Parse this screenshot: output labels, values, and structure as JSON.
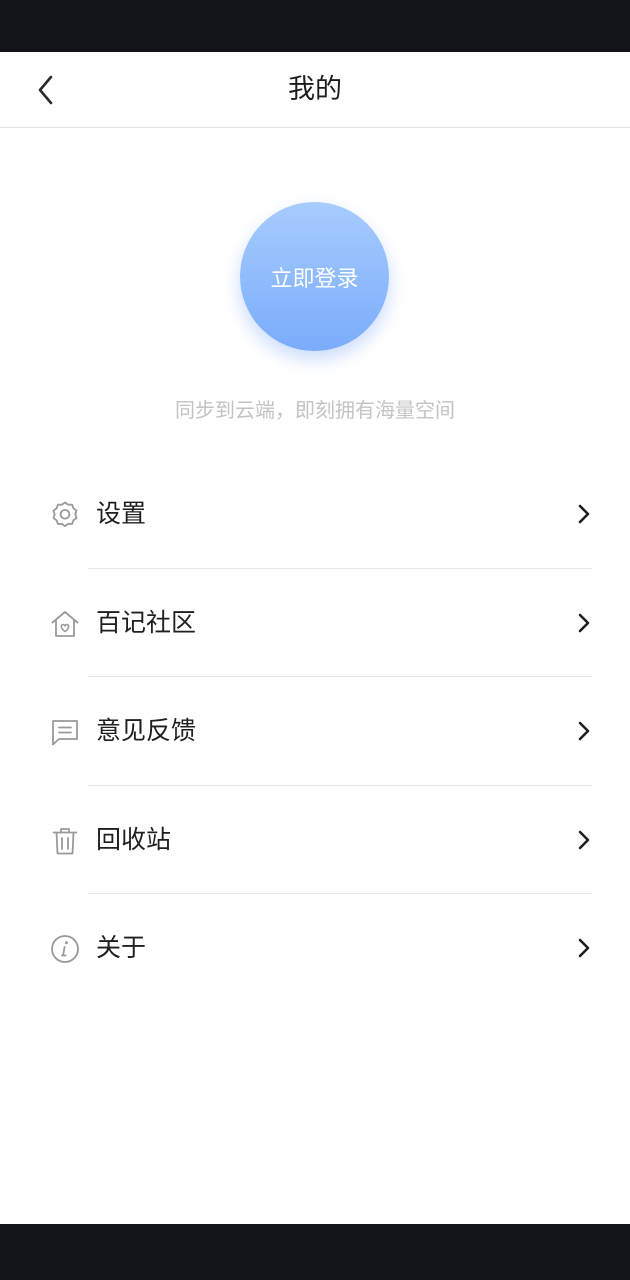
{
  "header": {
    "title": "我的",
    "back_icon": "chevron-left-icon"
  },
  "profile": {
    "login_label": "立即登录",
    "hint": "同步到云端，即刻拥有海量空间"
  },
  "menu": {
    "items": [
      {
        "label": "设置",
        "icon": "gear-icon"
      },
      {
        "label": "百记社区",
        "icon": "home-heart-icon"
      },
      {
        "label": "意见反馈",
        "icon": "message-icon"
      },
      {
        "label": "回收站",
        "icon": "trash-icon"
      },
      {
        "label": "关于",
        "icon": "info-icon"
      }
    ],
    "arrow_icon": "chevron-right-icon"
  },
  "colors": {
    "status_bar": "#12141a",
    "login_gradient_top": "#a7ccfd",
    "login_gradient_bottom": "#7aacfb",
    "hint_text": "#c3c3c3",
    "icon_stroke": "#9a9a9a"
  }
}
